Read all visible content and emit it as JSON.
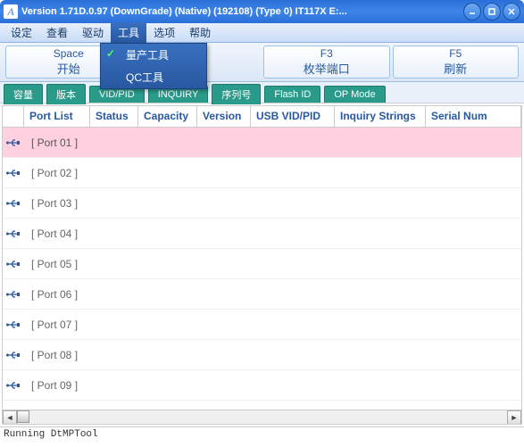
{
  "window": {
    "title": "Version 1.71D.0.97 (DownGrade) (Native) (192108) (Type 0) IT117X E:..."
  },
  "menu": {
    "items": [
      "设定",
      "查看",
      "驱动",
      "工具",
      "选项",
      "帮助"
    ],
    "active_index": 3,
    "dropdown": {
      "items": [
        {
          "label": "量产工具",
          "checked": true
        },
        {
          "label": "QC工具",
          "checked": false
        }
      ]
    }
  },
  "toolbar": {
    "buttons": [
      {
        "key": "Space",
        "label": "开始"
      },
      {
        "key": "",
        "label": ""
      },
      {
        "key": "F3",
        "label": "枚举端口"
      },
      {
        "key": "F5",
        "label": "刷新"
      }
    ]
  },
  "tabs": [
    "容量",
    "版本",
    "VID/PID",
    "INQUIRY",
    "序列号",
    "Flash ID",
    "OP Mode"
  ],
  "table": {
    "columns": [
      "Port List",
      "Status",
      "Capacity",
      "Version",
      "USB VID/PID",
      "Inquiry Strings",
      "Serial Num"
    ],
    "rows": [
      {
        "port": "[ Port 01 ]",
        "selected": true
      },
      {
        "port": "[ Port 02 ]",
        "selected": false
      },
      {
        "port": "[ Port 03 ]",
        "selected": false
      },
      {
        "port": "[ Port 04 ]",
        "selected": false
      },
      {
        "port": "[ Port 05 ]",
        "selected": false
      },
      {
        "port": "[ Port 06 ]",
        "selected": false
      },
      {
        "port": "[ Port 07 ]",
        "selected": false
      },
      {
        "port": "[ Port 08 ]",
        "selected": false
      },
      {
        "port": "[ Port 09 ]",
        "selected": false
      }
    ]
  },
  "status": "Running DtMPTool"
}
